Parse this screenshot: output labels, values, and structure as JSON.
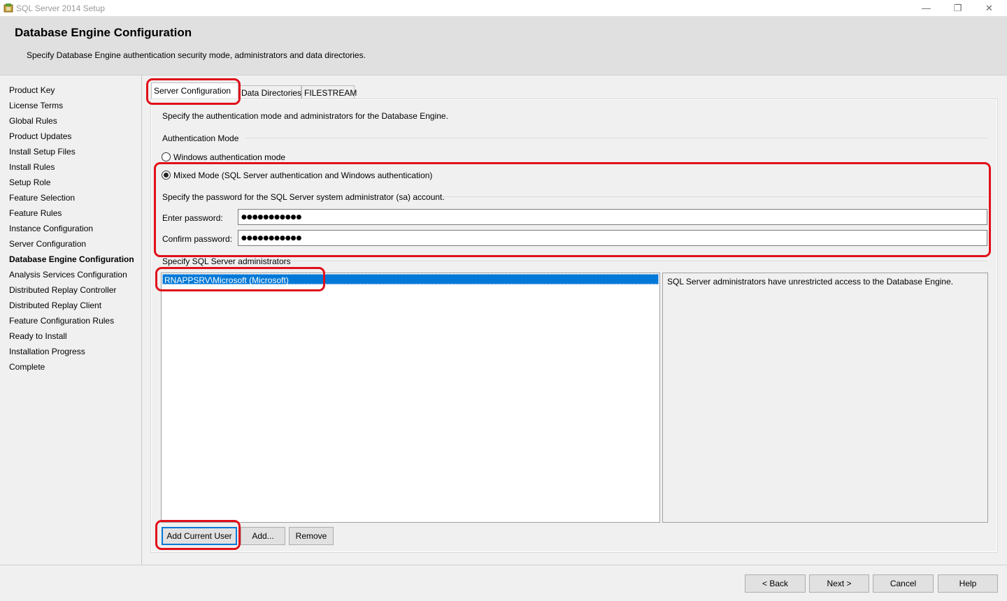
{
  "window": {
    "title": "SQL Server 2014 Setup",
    "minimize_glyph": "—",
    "maximize_glyph": "❐",
    "close_glyph": "✕"
  },
  "header": {
    "title": "Database Engine Configuration",
    "subtitle": "Specify Database Engine authentication security mode, administrators and data directories."
  },
  "sidebar": {
    "items": [
      {
        "label": "Product Key"
      },
      {
        "label": "License Terms"
      },
      {
        "label": "Global Rules"
      },
      {
        "label": "Product Updates"
      },
      {
        "label": "Install Setup Files"
      },
      {
        "label": "Install Rules"
      },
      {
        "label": "Setup Role"
      },
      {
        "label": "Feature Selection"
      },
      {
        "label": "Feature Rules"
      },
      {
        "label": "Instance Configuration"
      },
      {
        "label": "Server Configuration"
      },
      {
        "label": "Database Engine Configuration",
        "active": true
      },
      {
        "label": "Analysis Services Configuration"
      },
      {
        "label": "Distributed Replay Controller"
      },
      {
        "label": "Distributed Replay Client"
      },
      {
        "label": "Feature Configuration Rules"
      },
      {
        "label": "Ready to Install"
      },
      {
        "label": "Installation Progress"
      },
      {
        "label": "Complete"
      }
    ]
  },
  "tabs": [
    {
      "label": "Server Configuration",
      "selected": true
    },
    {
      "label": "Data Directories"
    },
    {
      "label": "FILESTREAM"
    }
  ],
  "server_config": {
    "intro": "Specify the authentication mode and administrators for the Database Engine.",
    "auth_mode_label": "Authentication Mode",
    "windows_auth_label": "Windows authentication mode",
    "mixed_mode_label": "Mixed Mode (SQL Server authentication and Windows authentication)",
    "selected_mode": "mixed",
    "sa_label": "Specify the password for the SQL Server system administrator (sa) account.",
    "enter_password_label": "Enter password:",
    "enter_password_value": "●●●●●●●●●●●",
    "confirm_password_label": "Confirm password:",
    "confirm_password_value": "●●●●●●●●●●●",
    "admins_label": "Specify SQL Server administrators",
    "admins": [
      "RNAPPSRV\\Microsoft (Microsoft)"
    ],
    "admins_description": "SQL Server administrators have unrestricted access to the Database Engine.",
    "add_current_user_label": "Add Current User",
    "add_label": "Add...",
    "remove_label": "Remove"
  },
  "footer": {
    "back_label": "< Back",
    "next_label": "Next >",
    "cancel_label": "Cancel",
    "help_label": "Help"
  },
  "colors": {
    "annotation": "#e0101a",
    "selection": "#0078d7"
  }
}
